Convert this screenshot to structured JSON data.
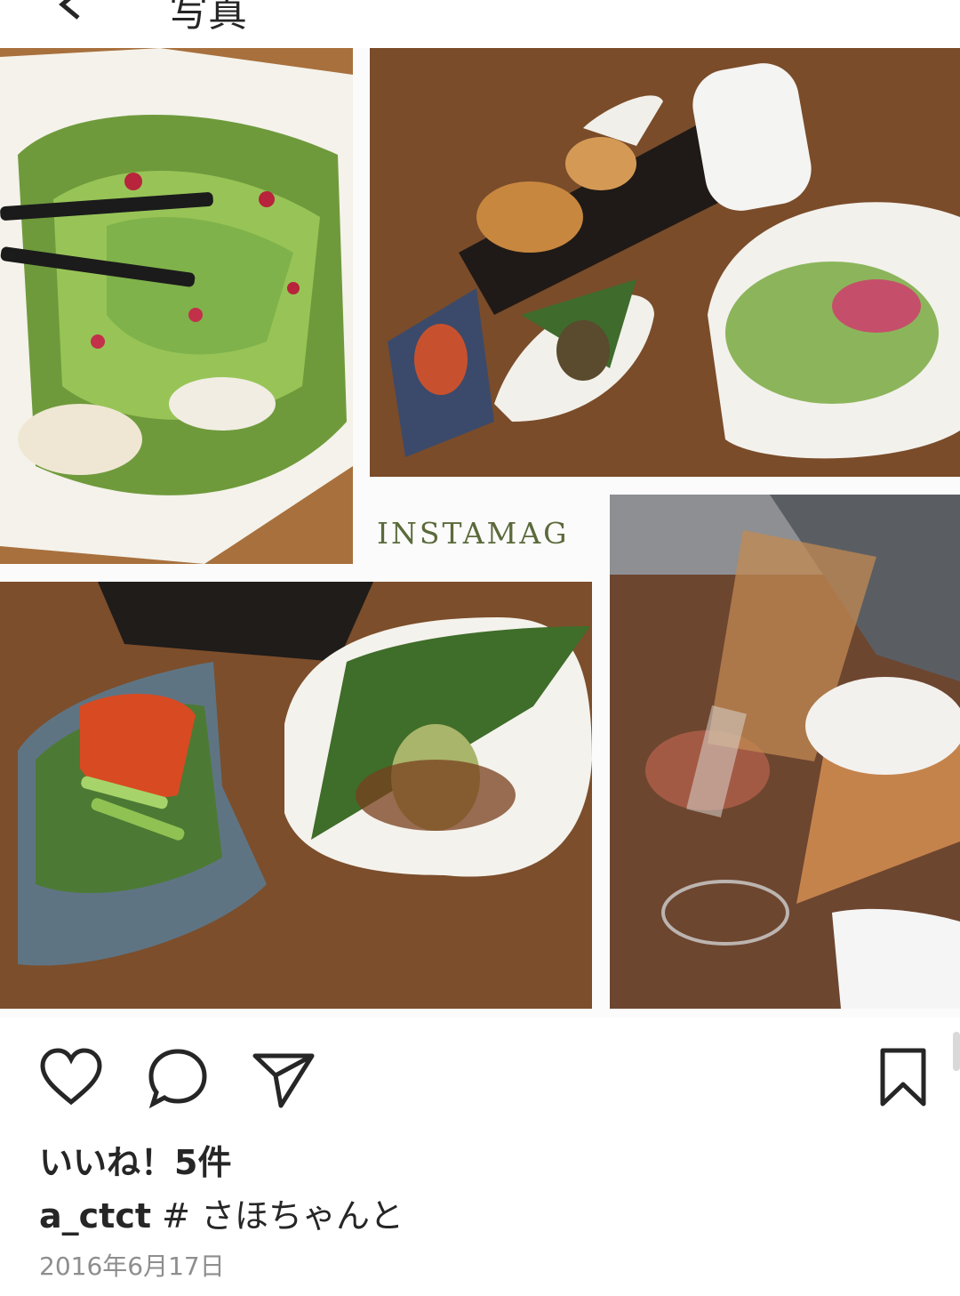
{
  "header": {
    "back_icon": "chevron-left-icon",
    "title_fragment": "写真"
  },
  "collage": {
    "brand_text": "INSTAMAG"
  },
  "actions": {
    "like_icon": "heart-icon",
    "comment_icon": "comment-icon",
    "share_icon": "send-icon",
    "save_icon": "bookmark-icon"
  },
  "post": {
    "likes": "いいね！5件",
    "username": "a_ctct",
    "caption": " # さほちゃんと",
    "date": "2016年6月17日"
  },
  "colors": {
    "text": "#262626",
    "muted": "#8e8e8e",
    "brand": "#5b6a3b"
  }
}
